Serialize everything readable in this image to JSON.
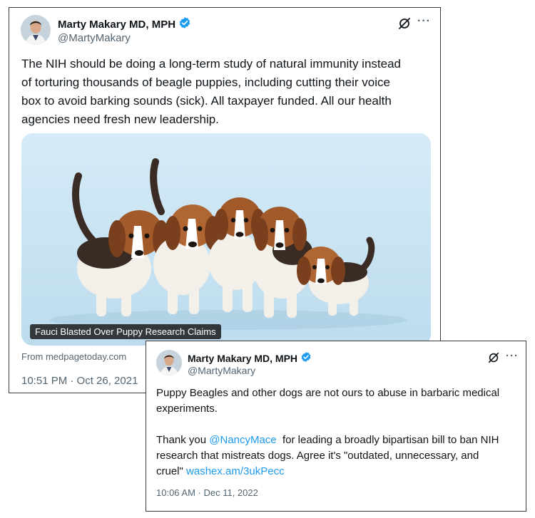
{
  "tweet1": {
    "author_name": "Marty Makary MD, MPH",
    "handle": "@MartyMakary",
    "icons": {
      "verified": "verified-badge-icon",
      "grok": "grok-icon",
      "more": "more-options-icon"
    },
    "text_lines": [
      "The NIH should be doing a long-term study of natural immunity instead",
      "of torturing thousands of beagle puppies, including cutting their voice",
      "box to avoid barking sounds (sick). All taxpayer funded. All our health",
      "agencies need fresh new leadership."
    ],
    "media_caption": "Fauci Blasted Over Puppy Research Claims",
    "link_source": "From medpagetoday.com",
    "timestamp": "10:51 PM · Oct 26, 2021"
  },
  "tweet2": {
    "author_name": "Marty Makary MD, MPH",
    "handle": "@MartyMakary",
    "icons": {
      "verified": "verified-badge-icon",
      "grok": "grok-icon",
      "more": "more-options-icon"
    },
    "para1_lines": [
      "Puppy Beagles and other dogs are not ours to abuse in barbaric medical",
      "experiments."
    ],
    "para2_prefix": "Thank you ",
    "mention": "@NancyMace",
    "para2_line1_rest": "  for leading a broadly bipartisan bill to ban NIH",
    "para2_line2": "research that mistreats dogs. Agree it's \"outdated, unnecessary, and",
    "para2_line3_prefix": "cruel\" ",
    "link": "washex.am/3ukPecc",
    "timestamp": "10:06 AM · Dec 11, 2022"
  },
  "colors": {
    "link": "#1d9bf0",
    "verified": "#1d9bf0",
    "secondary_text": "#536471",
    "media_bg": "#cfe6f3"
  }
}
